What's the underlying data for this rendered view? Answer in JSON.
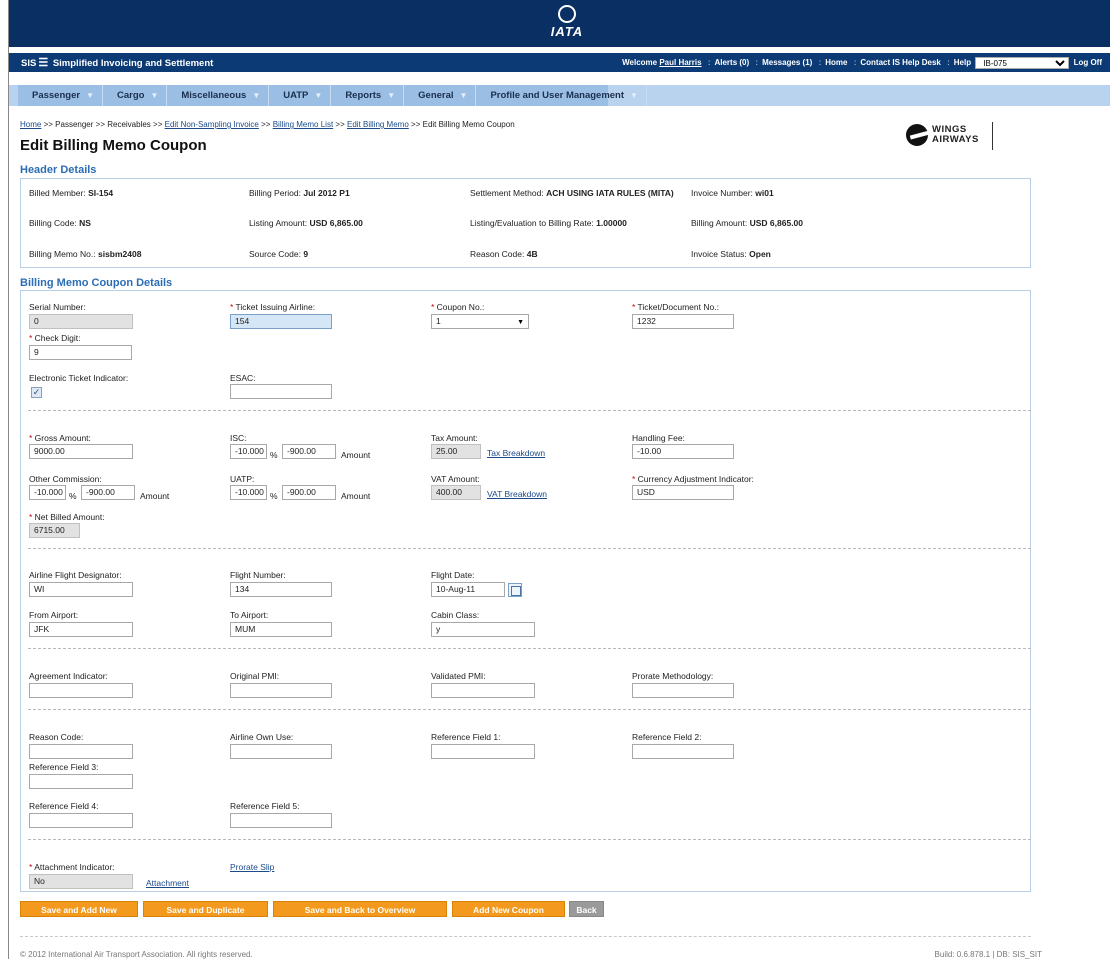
{
  "header_bar": {
    "logo_text": "IATA",
    "app_name": "Simplified Invoicing and Settlement",
    "app_prefix": "SIS",
    "welcome": "Welcome",
    "user": "Paul Harris",
    "alerts": "Alerts (0)",
    "messages": "Messages (1)",
    "home": "Home",
    "contact": "Contact IS Help Desk",
    "help": "Help",
    "member_select": "IB-075",
    "logoff": "Log Off"
  },
  "menu": [
    "Passenger",
    "Cargo",
    "Miscellaneous",
    "UATP",
    "Reports",
    "General",
    "Profile and User Management"
  ],
  "breadcrumb": {
    "home": "Home",
    "sep": ">>",
    "passenger": "Passenger",
    "receivables": "Receivables",
    "edit_invoice": "Edit Non-Sampling Invoice",
    "memo_list": "Billing Memo List",
    "edit_memo": "Edit Billing Memo",
    "current": "Edit Billing Memo Coupon"
  },
  "page_title": "Edit Billing Memo Coupon",
  "airline_logo": "WINGS AIRWAYS",
  "header_details": {
    "title": "Header Details",
    "billed_member_label": "Billed Member:",
    "billed_member": "SI-154",
    "billing_period_label": "Billing Period:",
    "billing_period": "Jul 2012 P1",
    "settlement_method_label": "Settlement Method:",
    "settlement_method": "ACH USING IATA RULES (MITA)",
    "invoice_number_label": "Invoice Number:",
    "invoice_number": "wi01",
    "billing_code_label": "Billing Code:",
    "billing_code": "NS",
    "listing_amount_label": "Listing Amount:",
    "listing_amount": "USD 6,865.00",
    "rate_label": "Listing/Evaluation to Billing Rate:",
    "rate": "1.00000",
    "billing_amount_label": "Billing Amount:",
    "billing_amount": "USD 6,865.00",
    "memo_no_label": "Billing Memo No.:",
    "memo_no": "sisbm2408",
    "source_code_label": "Source Code:",
    "source_code": "9",
    "reason_code_label": "Reason Code:",
    "reason_code": "4B",
    "invoice_status_label": "Invoice Status:",
    "invoice_status": "Open"
  },
  "coupon": {
    "title": "Billing Memo Coupon Details",
    "serial_label": "Serial Number:",
    "serial": "0",
    "tia_label": "Ticket Issuing Airline:",
    "tia": "154",
    "coupon_no_label": "Coupon No.:",
    "coupon_no": "1",
    "ticket_no_label": "Ticket/Document No.:",
    "ticket_no": "1232",
    "check_digit_label": "Check Digit:",
    "check_digit": "9",
    "eti_label": "Electronic Ticket Indicator:",
    "eti_checked": "✓",
    "esac_label": "ESAC:",
    "esac": "",
    "gross_label": "Gross Amount:",
    "gross": "9000.00",
    "isc_label": "ISC:",
    "isc_pct": "-10.000",
    "isc_amt": "-900.00",
    "pct_sign": "%",
    "amount_label": "Amount",
    "tax_label": "Tax Amount:",
    "tax": "25.00",
    "tax_link": "Tax Breakdown",
    "handling_label": "Handling Fee:",
    "handling": "-10.00",
    "other_comm_label": "Other Commission:",
    "other_pct": "-10.000",
    "other_amt": "-900.00",
    "uatp_label": "UATP:",
    "uatp_pct": "-10.000",
    "uatp_amt": "-900.00",
    "vat_label": "VAT Amount:",
    "vat": "400.00",
    "vat_link": "VAT Breakdown",
    "cai_label": "Currency Adjustment Indicator:",
    "cai": "USD",
    "net_label": "Net Billed Amount:",
    "net": "6715.00",
    "afd_label": "Airline Flight Designator:",
    "afd": "WI",
    "flight_no_label": "Flight Number:",
    "flight_no": "134",
    "flight_date_label": "Flight Date:",
    "flight_date": "10-Aug-11",
    "from_label": "From Airport:",
    "from": "JFK",
    "to_label": "To Airport:",
    "to": "MUM",
    "cabin_label": "Cabin Class:",
    "cabin": "y",
    "agreement_label": "Agreement Indicator:",
    "orig_pmi_label": "Original PMI:",
    "val_pmi_label": "Validated PMI:",
    "prorate_label": "Prorate Methodology:",
    "reason_label": "Reason Code:",
    "own_use_label": "Airline Own Use:",
    "ref1_label": "Reference Field 1:",
    "ref2_label": "Reference Field 2:",
    "ref3_label": "Reference Field 3:",
    "ref4_label": "Reference Field 4:",
    "ref5_label": "Reference Field 5:",
    "attach_ind_label": "Attachment Indicator:",
    "attach_ind": "No",
    "attach_link": "Attachment",
    "prorate_slip": "Prorate Slip"
  },
  "buttons": {
    "save_add": "Save and Add New",
    "save_dup": "Save and Duplicate",
    "save_back": "Save and Back to Overview",
    "add_coupon": "Add New Coupon",
    "back": "Back"
  },
  "footer": {
    "copyright": "© 2012 International Air Transport Association. All rights reserved.",
    "build": "Build: 0.6.878.1 | DB: SIS_SIT"
  }
}
